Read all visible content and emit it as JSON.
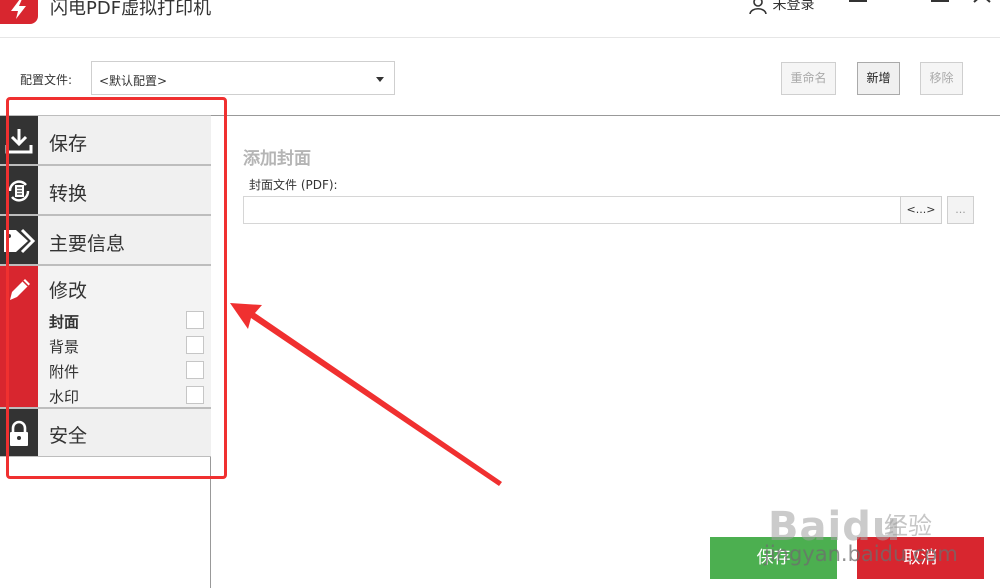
{
  "app": {
    "title": "闪电PDF虚拟打印机",
    "user": "未登录"
  },
  "config": {
    "label": "配置文件:",
    "selected": "<默认配置>",
    "rename": "重命名",
    "add": "新增",
    "remove": "移除"
  },
  "sidebar": {
    "save": "保存",
    "convert": "转换",
    "info": "主要信息",
    "modify": "修改",
    "security": "安全",
    "sub": {
      "cover": "封面",
      "background": "背景",
      "attachment": "附件",
      "watermark": "水印"
    }
  },
  "main": {
    "section_title": "添加封面",
    "file_label": "封面文件 (PDF):",
    "file_value": "",
    "browse": "<...>",
    "more": "..."
  },
  "actions": {
    "save": "保存",
    "cancel": "取消"
  },
  "watermark": {
    "logo": "Baidu",
    "brand": "经验",
    "url": "jingyan.baidu.com"
  },
  "colors": {
    "accent": "#d8262f",
    "save": "#4caf50",
    "icon_bg": "#333333",
    "annotation": "#f03030"
  },
  "icons": [
    "download-icon",
    "convert-icon",
    "tags-icon",
    "pencil-icon",
    "lock-icon"
  ]
}
